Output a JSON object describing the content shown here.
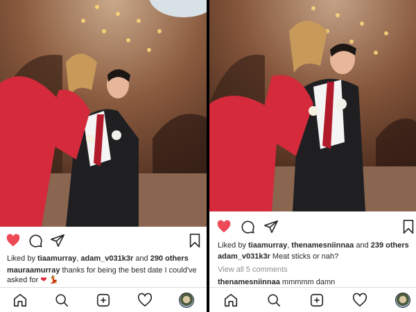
{
  "left_post": {
    "photo_alt": "prom photo",
    "liked_by": {
      "prefix": "Liked by ",
      "user1": "tiaamurray",
      "sep": ", ",
      "user2": "adam_v031k3r",
      "and": " and ",
      "count": "290 others"
    },
    "caption": {
      "user": "mauraamurray",
      "text": " thanks for being the best date I could've",
      "text2": "asked for"
    },
    "colors": {
      "liked_heart": "#ed4956"
    }
  },
  "right_post": {
    "photo_alt": "prom photo",
    "liked_by": {
      "prefix": "Liked by ",
      "user1": "tiaamurray",
      "sep": ", ",
      "user2": "thenamesniinnaa",
      "and": " and ",
      "count": "239 others"
    },
    "caption": {
      "user": "adam_v031k3r",
      "text": " Meat sticks or nah?"
    },
    "view_comments": "View all 5 comments",
    "comment": {
      "user": "thenamesniinnaa",
      "text": " mmmmm damn"
    },
    "colors": {
      "liked_heart": "#ed4956"
    }
  },
  "tabbar": {
    "icons": [
      "home-icon",
      "search-icon",
      "new-post-icon",
      "activity-heart-icon",
      "profile-avatar-icon"
    ]
  }
}
